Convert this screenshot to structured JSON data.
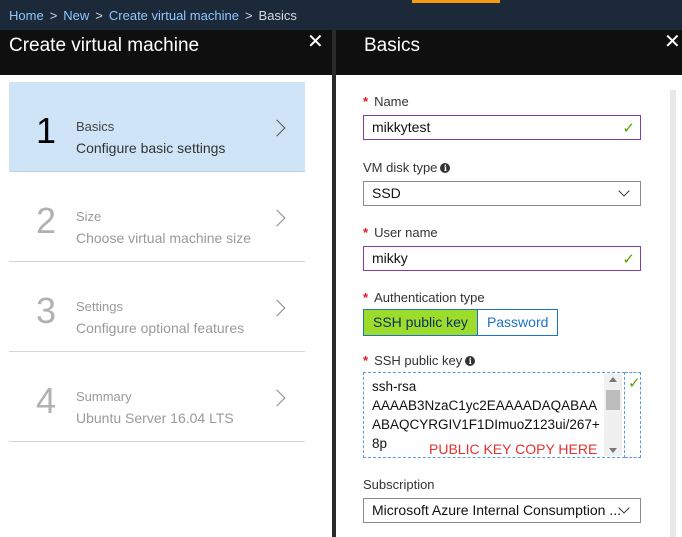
{
  "breadcrumb": {
    "items": [
      "Home",
      "New",
      "Create virtual machine"
    ],
    "current": "Basics",
    "separator": ">"
  },
  "left_blade": {
    "title": "Create virtual machine",
    "close_glyph": "✕",
    "steps": [
      {
        "number": "1",
        "name": "Basics",
        "desc": "Configure basic settings",
        "active": true
      },
      {
        "number": "2",
        "name": "Size",
        "desc": "Choose virtual machine size",
        "active": false
      },
      {
        "number": "3",
        "name": "Settings",
        "desc": "Configure optional features",
        "active": false
      },
      {
        "number": "4",
        "name": "Summary",
        "desc": "Ubuntu Server 16.04 LTS",
        "active": false
      }
    ]
  },
  "right_blade": {
    "title": "Basics",
    "close_glyph": "✕",
    "name": {
      "label": "Name",
      "value": "mikkytest"
    },
    "disk_type": {
      "label": "VM disk type",
      "value": "SSD"
    },
    "user_name": {
      "label": "User name",
      "value": "mikky"
    },
    "auth": {
      "label": "Authentication type",
      "options": [
        "SSH public key",
        "Password"
      ],
      "selected": "SSH public key"
    },
    "ssh_key": {
      "label": "SSH public key",
      "lines": [
        "ssh-rsa",
        "AAAAB3NzaC1yc2EAAAADAQABAA",
        "ABAQCYRGIV1F1DImuoZ123ui/267+",
        "8p"
      ],
      "annotation": "PUBLIC KEY COPY HERE"
    },
    "subscription": {
      "label": "Subscription",
      "value": "Microsoft Azure Internal Consumption ..."
    }
  },
  "glyphs": {
    "required": "*",
    "check": "✓",
    "info": "i"
  },
  "colors": {
    "accent": "#f39c12",
    "required": "#e81123",
    "valid": "#57a300",
    "selected_toggle": "#7ac943",
    "link": "#1a73c7"
  }
}
